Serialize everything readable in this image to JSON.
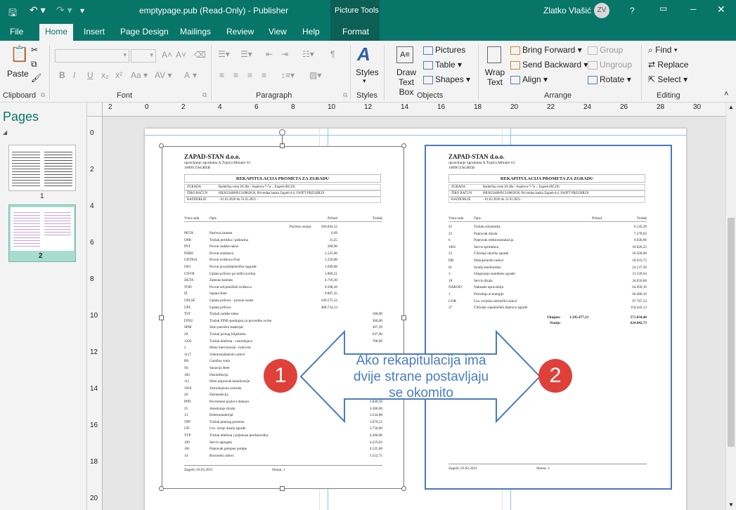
{
  "window": {
    "title": "emptypage.pub (Read-Only)  -  Publisher",
    "context_tab": "Picture Tools",
    "user": "Zlatko Vlašić",
    "user_initials": "ZV",
    "help": "?"
  },
  "tabs": [
    "File",
    "Home",
    "Insert",
    "Page Design",
    "Mailings",
    "Review",
    "View",
    "Help",
    "Format"
  ],
  "ribbon": {
    "clipboard": {
      "label": "Clipboard",
      "paste": "Paste"
    },
    "font": {
      "label": "Font",
      "bold": "B",
      "italic": "I",
      "underline": "U",
      "sub": "x₂",
      "sup": "x²",
      "font_color": "A"
    },
    "paragraph": {
      "label": "Paragraph"
    },
    "styles": {
      "label": "Styles",
      "button": "Styles"
    },
    "objects": {
      "label": "Objects",
      "draw_text_box": "Draw Text Box",
      "pictures": "Pictures",
      "table": "Table",
      "shapes": "Shapes"
    },
    "arrange": {
      "label": "Arrange",
      "wrap_text": "Wrap Text",
      "bring_forward": "Bring Forward",
      "send_backward": "Send Backward",
      "align": "Align",
      "group": "Group",
      "ungroup": "Ungroup",
      "rotate": "Rotate"
    },
    "editing": {
      "label": "Editing",
      "find": "Find",
      "replace": "Replace",
      "select": "Select"
    }
  },
  "pages_pane": {
    "title": "Pages",
    "pages": [
      "1",
      "2"
    ]
  },
  "ruler_h": [
    "2",
    "0",
    "2",
    "4",
    "6",
    "8",
    "10",
    "12",
    "14",
    "16",
    "18",
    "20",
    "22",
    "24",
    "26",
    "28",
    "30"
  ],
  "ruler_v": [
    "0",
    "2",
    "4",
    "6",
    "8",
    "10",
    "12",
    "14",
    "16",
    "18",
    "20"
  ],
  "doc_left": {
    "company": "ZAPAD-STAN d.o.o.",
    "addr1": "upravljanje zgradama A.Topića Mimare 61",
    "addr2": "10090 ZAGREB",
    "heading": "REKAPITULACIJA PROMETA ZA ZGRADU",
    "info": [
      [
        "ZGRADA",
        "Radnička cesta 20-20a - Supilova 7-7a -, Zagreb (RC20)"
      ],
      [
        "ŽIRO RAČUN",
        "HR3023400091310862636, Privredna banka Zagreb d.d. SWIFT PBZGHR2X"
      ],
      [
        "RAZDOBLJE",
        "- 01.02.2020 do 31.01.2021 -"
      ]
    ],
    "cols": [
      "Vrsta rada",
      "Opis",
      "Prihod",
      "Trošak"
    ],
    "opening": "Početno stanje:",
    "opening_val": "566.844,52",
    "rows": [
      [
        "PKTA",
        "Pasivna kamata",
        "6,69",
        ""
      ],
      [
        "O6R",
        "Trošak preslika i poštarina",
        "31,25",
        ""
      ],
      [
        "PST",
        "Povrat sudske takse",
        "200,00",
        ""
      ],
      [
        "PSRD",
        "Povrat sredstava",
        "3.125,00",
        ""
      ],
      [
        "UDT024",
        "Povrat troškova  Fine",
        "1.220,00",
        ""
      ],
      [
        "O63",
        "Povrat javnobilježničke nagrade",
        "1.699,00",
        ""
      ],
      [
        "UOVR",
        "Uplata pričuve po tužbi (ovrha)",
        "1.869,21",
        ""
      ],
      [
        "ZKTA",
        "Zatezna kamata",
        "4.716,30",
        ""
      ],
      [
        "TOD",
        "Povrat odvjetničkih troškova",
        "9.568,26",
        ""
      ],
      [
        "IŠ",
        "Isplata štete",
        "9.887,25",
        ""
      ],
      [
        "UPLSF",
        "Uplata pričuve - pravne osobe",
        "109.575,52",
        ""
      ],
      [
        "UPL",
        "Uplata pričuve",
        "408.734,13",
        ""
      ],
      [
        "TST",
        "Trošak sudske takse",
        "",
        "100,00"
      ],
      [
        "DT62",
        "Trošak FINE-predujam za provedbu ovrhe",
        "",
        "300,00"
      ],
      [
        "SPM",
        "Sitni potrošni materijal",
        "",
        "367,39"
      ],
      [
        "29",
        "Trošak javnog bilježnika",
        "",
        "637,00"
      ],
      [
        "1203",
        "Trošak telefona - vatrodojava",
        "",
        "708,00"
      ],
      [
        "2",
        "Hitne intervencije- vodovod",
        "",
        ""
      ],
      [
        "1117",
        "Vodoinstalaterski radovi",
        "",
        ""
      ],
      [
        "B6",
        "Garažna vrata",
        "",
        ""
      ],
      [
        "SS",
        "Sanacija štete",
        "",
        ""
      ],
      [
        "184",
        "Dezinfekcija",
        "",
        ""
      ],
      [
        "111",
        "Hitni popravak kanalizacije",
        "",
        ""
      ],
      [
        "1019",
        "Vatrodojavna centrala",
        "",
        ""
      ],
      [
        "20",
        "Dezinsekcija",
        "",
        ""
      ],
      [
        "PPD",
        "Povremeni poslovi domara",
        "",
        "3.020,39"
      ],
      [
        "25",
        "Atestiranje dizala",
        "",
        "3.300,00"
      ],
      [
        "13",
        "Elektromaterijal",
        "",
        "3.534,88"
      ],
      [
        "TPP",
        "Trošak platnog prometa",
        "",
        "3.679,53"
      ],
      [
        "UD",
        "Usv. izrnje dizala zgrade",
        "",
        "3.750,00"
      ],
      [
        "TTP",
        "Trošak telefona i prijenosa predstavnika",
        "",
        "4.200,00"
      ],
      [
        "169",
        "Servis agregata",
        "",
        "4.219,03"
      ],
      [
        "181",
        "Popravak potopne pumpe",
        "",
        "4.525,00"
      ],
      [
        "14",
        "Bravarski radovi",
        "",
        "5.552,75"
      ]
    ],
    "footer_left": "Zagreb, 03.02.2021",
    "footer_right": "Strana: 1"
  },
  "doc_right": {
    "company": "ZAPAD-STAN d.o.o.",
    "addr1": "upravljanje zgradama A.Topića Mimare 61",
    "addr2": "10090 ZAGREB",
    "heading": "REKAPITULACIJA PROMETA ZA ZGRADU",
    "info": [
      [
        "ZGRADA",
        "Radnička cesta 20-20a - Supilova 7-7a -, Zagreb (RC20)"
      ],
      [
        "ŽIRO RAČUN",
        "HR3023400091310862636, Privredna banka Zagreb d.d. SWIFT PBZGHR2X"
      ],
      [
        "RAZDOBLJE",
        "- 01.02.2020 do 31.01.2021 -"
      ]
    ],
    "cols": [
      "Vrsta rada",
      "Opis",
      "Prihod",
      "Trošak"
    ],
    "rows": [
      [
        "41",
        "Trošak odvjetnika",
        "",
        "6.145,39"
      ],
      [
        "22",
        "Popravak dizala",
        "",
        "7.278,03"
      ],
      [
        "6",
        "Popravak elektroinstalacija",
        "",
        "9.036,66"
      ],
      [
        "1001",
        "Servis sprinklera",
        "",
        "18.026,25"
      ],
      [
        "53",
        "Čišćenje okoliša zgrade",
        "",
        "18.500,00"
      ],
      [
        "DR",
        "Dimnjačarski radovi",
        "",
        "18.933,75"
      ],
      [
        "IS",
        "Izrada smetlarnika",
        "",
        "24.137,50"
      ],
      [
        "3",
        "Osiguranje stambene zgrade",
        "",
        "31.539,64"
      ],
      [
        "18",
        "Servis dizala",
        "",
        "34.650,00"
      ],
      [
        "NAKOD",
        "Naknada upravitelju",
        "",
        "64.058,16"
      ],
      [
        "1",
        "Potrošnja el.energije",
        "",
        "66.400,16"
      ],
      [
        "GOR",
        "Gra. evinsko-obrtnički radovi",
        "",
        "97.767,23"
      ],
      [
        "37",
        "Čišćenje zajedničkih dijelova zgrade",
        "",
        "118.443,13"
      ]
    ],
    "total_label": "Ukupno:",
    "total_income": "1.195.477,13",
    "total_cost": "571.034,40",
    "balance_label": "Stanje:",
    "balance": "624.442,73",
    "footer_left": "Zagreb, 03.02.2021",
    "footer_right": "Strana: 2"
  },
  "annotation": {
    "badge1": "1",
    "badge2": "2",
    "text_line1": "Ako rekapitulacija ima",
    "text_line2": "dvije strane postavljaju",
    "text_line3": "se okomito",
    "color": "#4a7cc2",
    "badge_color": "#e0403a"
  },
  "colors": {
    "accent": "#077568",
    "selection": "#4a78c0"
  }
}
